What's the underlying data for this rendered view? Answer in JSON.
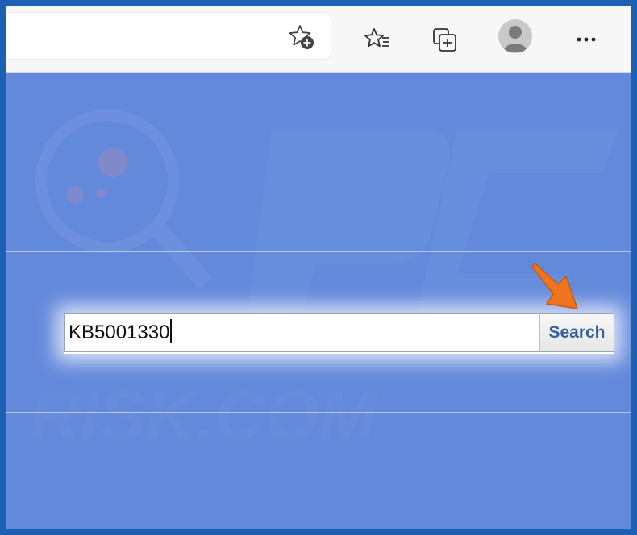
{
  "browser": {
    "toolbar": {
      "favorites_add_icon": "star-add-icon",
      "favorites_icon": "favorites-list-icon",
      "collections_icon": "collections-icon",
      "profile_icon": "avatar-icon",
      "more_icon": "more-horizontal-icon",
      "more_label": "···"
    }
  },
  "page": {
    "search": {
      "value": "KB5001330",
      "button_label": "Search"
    },
    "annotation": {
      "arrow_icon": "orange-pointer-arrow-icon",
      "arrow_color": "#ee7420"
    },
    "colors": {
      "page_background": "#6389db",
      "frame_border": "#1c5fb3",
      "search_button_text": "#33609f"
    }
  }
}
